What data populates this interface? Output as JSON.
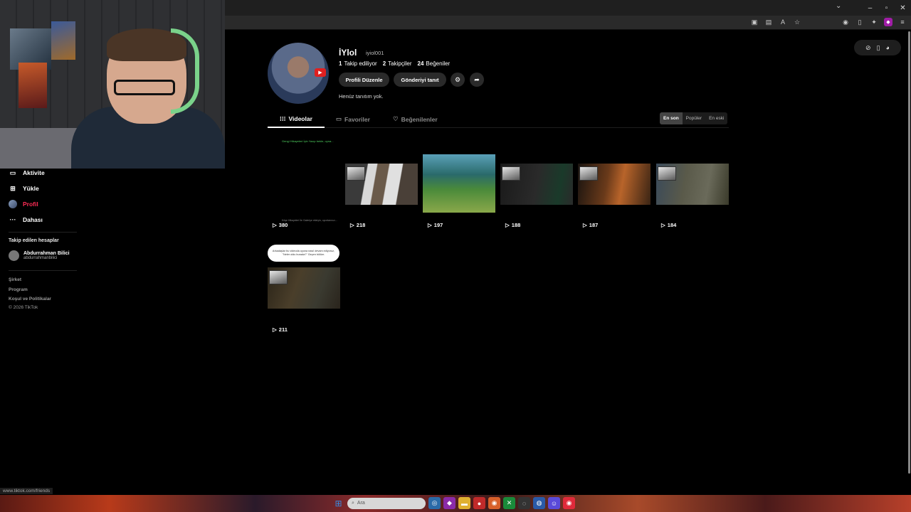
{
  "profile": {
    "display_name": "İYlol",
    "handle": "iyiol001",
    "following_count": "1",
    "following_label": "Takip ediliyor",
    "followers_count": "2",
    "followers_label": "Takipçiler",
    "likes_count": "24",
    "likes_label": "Beğeniler",
    "edit_button": "Profili Düzenle",
    "promote_button": "Gönderiyi tanıt",
    "bio": "Henüz tanıtım yok."
  },
  "tabs": [
    {
      "label": "Videolar",
      "active": true
    },
    {
      "label": "Favoriler",
      "active": false
    },
    {
      "label": "Beğenilenler",
      "active": false
    }
  ],
  "sort_options": [
    {
      "label": "En son",
      "active": true
    },
    {
      "label": "Popüler",
      "active": false
    },
    {
      "label": "En eski",
      "active": false
    }
  ],
  "sidebar": {
    "items": [
      {
        "label": "Aktivite",
        "icon": "activity-icon"
      },
      {
        "label": "Yükle",
        "icon": "upload-icon"
      },
      {
        "label": "Profil",
        "icon": "avatar"
      },
      {
        "label": "Dahası",
        "icon": "more-icon"
      }
    ],
    "following_heading": "Takip edilen hesaplar",
    "following_accounts": [
      {
        "name": "Abdurrahman Bilici",
        "handle": "abdurrahmanbilici"
      }
    ],
    "footer_links": [
      "Şirket",
      "Program",
      "Koşul ve Politikalar"
    ],
    "copyright": "© 2026 TikTok"
  },
  "videos": [
    {
      "views": "380",
      "caption_top": "Gengi Hikayeleri İçin Yazıp bekle, oyna...",
      "caption_bottom": "Köşe Hikayeleri İle Galeriye ekleyin, oyunlarınızı..."
    },
    {
      "views": "218"
    },
    {
      "views": "197"
    },
    {
      "views": "188"
    },
    {
      "views": "187"
    },
    {
      "views": "184"
    },
    {
      "views": "211",
      "bubble": "Arkadaşlar bu videoda oyuna nasıl devam ediyoruz, \"Neler oldu burada?\" Geçen bölüm."
    }
  ],
  "status_url": "www.tiktok.com/friends",
  "taskbar": {
    "search_placeholder": "Ara"
  },
  "colors": {
    "accent": "#fe2c55",
    "background": "#000000",
    "button": "#2a2a2a"
  }
}
